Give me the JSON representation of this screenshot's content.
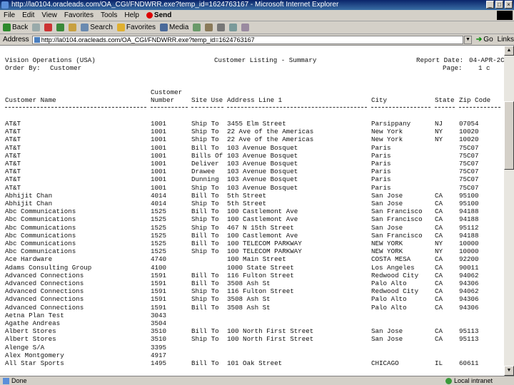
{
  "window": {
    "title": "http://la0104.oracleads.com/OA_CGI/FNDWRR.exe?temp_id=1624763167 - Microsoft Internet Explorer"
  },
  "menu": [
    "File",
    "Edit",
    "View",
    "Favorites",
    "Tools",
    "Help"
  ],
  "menu_send": "Send",
  "toolbar": {
    "back": "Back",
    "search": "Search",
    "favorites": "Favorites",
    "media": "Media"
  },
  "address": {
    "label": "Address",
    "value": "http://la0104.oracleads.com/OA_CGI/FNDWRR.exe?temp_id=1624763167",
    "go": "Go",
    "links": "Links"
  },
  "report": {
    "company": "Vision Operations (USA)",
    "title": "Customer Listing - Summary",
    "report_date_label": "Report Date:",
    "report_date": "04-APR-2C",
    "order_by_label": "Order By:",
    "order_by": "Customer",
    "page_label": "Page:",
    "page": "1 c",
    "columns": {
      "customer_name": "Customer Name",
      "customer_number_top": "Customer",
      "customer_number_bottom": "Number",
      "site_use": "Site Use",
      "address_line": "Address Line 1",
      "city": "City",
      "state": "State",
      "zip": "Zip Code"
    },
    "rows": [
      [
        "AT&T",
        "1001",
        "Ship To",
        "3455 Elm Street",
        "Parsippany",
        "NJ",
        "07054"
      ],
      [
        "AT&T",
        "1001",
        "Ship To",
        "22 Ave of the Americas",
        "New York",
        "NY",
        "10020"
      ],
      [
        "AT&T",
        "1001",
        "Ship To",
        "22 Ave of the Americas",
        "New York",
        "NY",
        "10020"
      ],
      [
        "AT&T",
        "1001",
        "Bill To",
        "103 Avenue Bosquet",
        "Paris",
        "",
        "75C07"
      ],
      [
        "AT&T",
        "1001",
        "Bills Of",
        "103 Avenue Bosquet",
        "Paris",
        "",
        "75C07"
      ],
      [
        "AT&T",
        "1001",
        "Deliver",
        "103 Avenue Bosquet",
        "Paris",
        "",
        "75C07"
      ],
      [
        "AT&T",
        "1001",
        "Drawee",
        "103 Avenue Bosquet",
        "Paris",
        "",
        "75C07"
      ],
      [
        "AT&T",
        "1001",
        "Dunning",
        "103 Avenue Bosquet",
        "Paris",
        "",
        "75C07"
      ],
      [
        "AT&T",
        "1001",
        "Ship To",
        "103 Avenue Bosquet",
        "Paris",
        "",
        "75C07"
      ],
      [
        "Abhijit Chan",
        "4014",
        "Bill To",
        "5th Street",
        "San Jose",
        "CA",
        "95100"
      ],
      [
        "Abhijit Chan",
        "4014",
        "Ship To",
        "5th Street",
        "San Jose",
        "CA",
        "95100"
      ],
      [
        "Abc Communications",
        "1525",
        "Bill To",
        "100 Castlemont Ave",
        "San Francisco",
        "CA",
        "94188"
      ],
      [
        "Abc Communications",
        "1525",
        "Ship To",
        "100 Castlemont Ave",
        "San Francisco",
        "CA",
        "94188"
      ],
      [
        "Abc Communications",
        "1525",
        "Ship To",
        "467 N 15th Street",
        "San Jose",
        "CA",
        "95112"
      ],
      [
        "Abc Communications",
        "1525",
        "Bill To",
        "100 Castlemont Ave",
        "San Francisco",
        "CA",
        "94188"
      ],
      [
        "Abc Communications",
        "1525",
        "Bill To",
        "100 TELECOM PARKWAY",
        "NEW YORK",
        "NY",
        "10000"
      ],
      [
        "Abc Communications",
        "1525",
        "Ship To",
        "100 TELECOM PARKWAY",
        "NEW YORK",
        "NY",
        "10000"
      ],
      [
        "Ace Hardware",
        "4740",
        "",
        "100 Main Street",
        "COSTA MESA",
        "CA",
        "92200"
      ],
      [
        "Adams Consulting Group",
        "4100",
        "",
        "1000 State Street",
        "Los Angeles",
        "CA",
        "90011"
      ],
      [
        "Advanced Connections",
        "1591",
        "Bill To",
        "116 Fulton Street",
        "Redwood City",
        "CA",
        "94062"
      ],
      [
        "Advanced Connections",
        "1591",
        "Bill To",
        "3508 Ash St",
        "Palo Alto",
        "CA",
        "94306"
      ],
      [
        "Advanced Connections",
        "1591",
        "Ship To",
        "116 Fulton Street",
        "Redwood City",
        "CA",
        "94062"
      ],
      [
        "Advanced Connections",
        "1591",
        "Ship To",
        "3508 Ash St",
        "Palo Alto",
        "CA",
        "94306"
      ],
      [
        "Advanced Connections",
        "1591",
        "Bill To",
        "3508 Ash St",
        "Palo Alto",
        "CA",
        "94306"
      ],
      [
        "Aetna Plan Test",
        "3043",
        "",
        "",
        "",
        "",
        ""
      ],
      [
        "Agathe Andreas",
        "3504",
        "",
        "",
        "",
        "",
        ""
      ],
      [
        "Albert Stores",
        "3510",
        "Bill To",
        "100 North First Street",
        "San Jose",
        "CA",
        "95113"
      ],
      [
        "Albert Stores",
        "3510",
        "Ship To",
        "100 North First Street",
        "San Jose",
        "CA",
        "95113"
      ],
      [
        "Alenge S/A",
        "3395",
        "",
        "",
        "",
        "",
        ""
      ],
      [
        "Alex Montgomery",
        "4917",
        "",
        "",
        "",
        "",
        ""
      ],
      [
        "All Star Sports",
        "1495",
        "Bill To",
        "101 Oak Street",
        "CHICAGO",
        "IL",
        "60611"
      ]
    ]
  },
  "status": {
    "left": "Done",
    "zone": "Local intranet"
  }
}
